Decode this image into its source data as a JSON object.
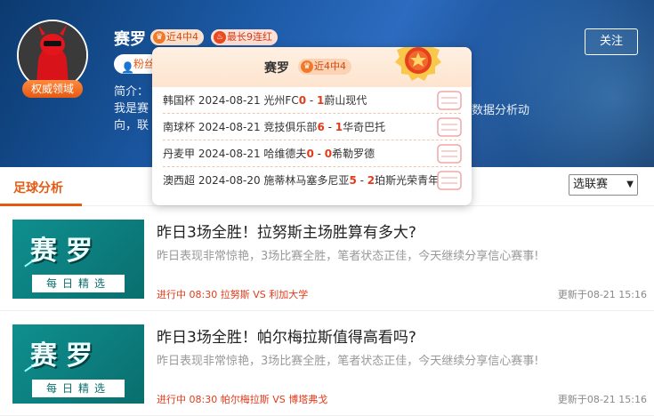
{
  "profile": {
    "name": "赛罗",
    "avatar_badge": "权威领域",
    "tag_recent": "近4中4",
    "tag_streak": "最长9连红",
    "fans_label": "粉丝",
    "intro_line1": "简介：",
    "intro_line2": "我是赛",
    "intro_line3": "向，联",
    "intro_right": "数据分析动",
    "follow_label": "关注"
  },
  "tabs": {
    "active": "足球分析",
    "league_select": "选联赛"
  },
  "popup": {
    "name": "赛罗",
    "tag": "近4中4",
    "matches": [
      {
        "league": "韩国杯",
        "date": "2024-08-21",
        "home": "光州FC",
        "hs": "0",
        "sep": " - ",
        "as": "1",
        "away": "蔚山现代"
      },
      {
        "league": "南球杯",
        "date": "2024-08-21",
        "home": "竞技俱乐部",
        "hs": "6",
        "sep": " - ",
        "as": "1",
        "away": "华奇巴托"
      },
      {
        "league": "丹麦甲",
        "date": "2024-08-21",
        "home": "哈维德夫",
        "hs": "0",
        "sep": " - ",
        "as": "0",
        "away": "希勒罗德"
      },
      {
        "league": "澳西超",
        "date": "2024-08-20",
        "home": "施蒂林马塞多尼亚",
        "hs": "5",
        "sep": " - ",
        "as": "2",
        "away": "珀斯光荣青年"
      }
    ]
  },
  "articles": [
    {
      "thumb_big": "赛罗",
      "thumb_strip": "每日精选",
      "title": "昨日3场全胜！拉努斯主场胜算有多大?",
      "desc": "昨日表现非常惊艳，3场比赛全胜，笔者状态正佳，今天继续分享信心赛事!",
      "meta": "进行中 08:30 拉努斯 VS 利加大学",
      "time": "更新于08-21 15:16"
    },
    {
      "thumb_big": "赛罗",
      "thumb_strip": "每日精选",
      "title": "昨日3场全胜！帕尔梅拉斯值得高看吗?",
      "desc": "昨日表现非常惊艳，3场比赛全胜，笔者状态正佳，今天继续分享信心赛事!",
      "meta": "进行中 08:30 帕尔梅拉斯 VS 博塔弗戈",
      "time": "更新于08-21 15:16"
    }
  ],
  "colors": {
    "accent": "#e55a12",
    "score_red": "#e23b1a",
    "banner_blue": "#1c5aa6"
  }
}
